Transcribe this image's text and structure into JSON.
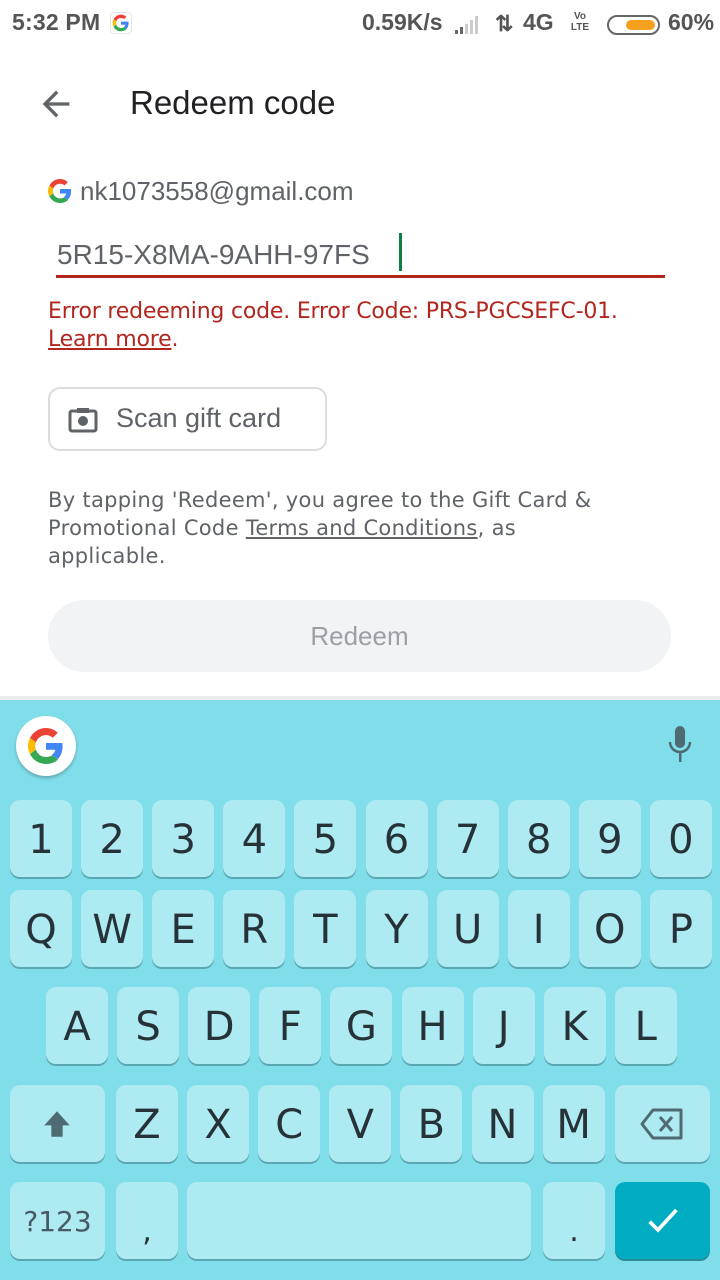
{
  "status_bar": {
    "time": "5:32 PM",
    "net_speed": "0.59K/s",
    "network": "4G",
    "volte": "Vo LTE",
    "battery_percent": "60%",
    "battery_level": 0.6,
    "battery_color": "#f7a01d"
  },
  "app_bar": {
    "back_icon": "arrow-left-icon",
    "title": "Redeem code"
  },
  "account": {
    "icon": "google-g-icon",
    "email": "nk1073558@gmail.com"
  },
  "code_input": {
    "value": "5R15-X8MA-9AHH-97FS",
    "error_color": "#b3261e",
    "caret_color": "#0b8043"
  },
  "error": {
    "message": "Error redeeming code. Error Code: PRS-PGCSEFC-01.",
    "link": "Learn more",
    "suffix": "."
  },
  "scan_button": {
    "icon": "camera-icon",
    "label": "Scan gift card"
  },
  "terms": {
    "prefix": "By tapping 'Redeem', you agree to the Gift Card & Promotional Code ",
    "link": "Terms and Conditions",
    "suffix": ", as applicable."
  },
  "redeem_button": {
    "label": "Redeem",
    "enabled": false
  },
  "keyboard": {
    "background": "#80deea",
    "key_color": "#aeeaf2",
    "enter_color": "#00acc1",
    "number_row": [
      "1",
      "2",
      "3",
      "4",
      "5",
      "6",
      "7",
      "8",
      "9",
      "0"
    ],
    "row1": [
      "Q",
      "W",
      "E",
      "R",
      "T",
      "Y",
      "U",
      "I",
      "O",
      "P"
    ],
    "row2": [
      "A",
      "S",
      "D",
      "F",
      "G",
      "H",
      "J",
      "K",
      "L"
    ],
    "row3": [
      "Z",
      "X",
      "C",
      "V",
      "B",
      "N",
      "M"
    ],
    "symbols_label": "?123",
    "comma": ",",
    "period": "."
  }
}
